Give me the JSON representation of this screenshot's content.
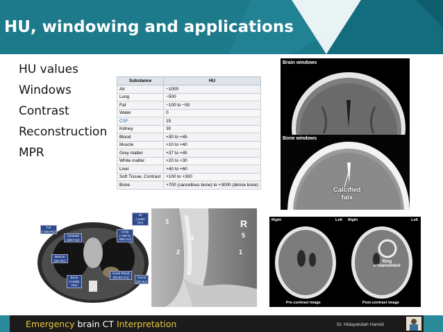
{
  "slide": {
    "title": "HU, windowing and applications",
    "bullets": [
      "HU values",
      "Windows",
      "Contrast",
      "Reconstruction",
      "MPR"
    ]
  },
  "hu_table": {
    "headers": [
      "Substance",
      "HU"
    ],
    "rows": [
      [
        "Air",
        "−1000"
      ],
      [
        "Lung",
        "−500"
      ],
      [
        "Fat",
        "−100 to −50"
      ],
      [
        "Water",
        "0"
      ],
      [
        "CSF",
        "15"
      ],
      [
        "Kidney",
        "30"
      ],
      [
        "Blood",
        "+30 to +45"
      ],
      [
        "Muscle",
        "+10 to +40"
      ],
      [
        "Grey matter",
        "+37 to +45"
      ],
      [
        "White matter",
        "+20 to +30"
      ],
      [
        "Liver",
        "+40 to +60"
      ],
      [
        "Soft Tissue, Contrast",
        "+100 to +300"
      ],
      [
        "Bone",
        "+700 (cancellous bone) to +3000 (dense bone)"
      ]
    ]
  },
  "images": {
    "brain_windows": "Brain windows",
    "bone_windows": "Bone windows",
    "calcified_falx": [
      "Calcified",
      "falx"
    ],
    "ct_labels": {
      "air": [
        "Air",
        "(-1000 HU)"
      ],
      "fat": [
        "Fat",
        "(-100 HU)"
      ],
      "lung": [
        "Lung",
        "(-750 to",
        "-900 HU)"
      ],
      "contrast": [
        "Contrast",
        "(300 HU)"
      ],
      "muscle": [
        "Muscle",
        "(50 HU)"
      ],
      "bone": [
        "Bone",
        "(>1000",
        "HU)"
      ],
      "acute_blood": [
        "Acute Blood",
        "(50-80 HU)"
      ],
      "tumor": [
        "Tumor",
        "(60 HU)"
      ]
    },
    "xray_marks": {
      "r": "R",
      "n3": "3",
      "n4": "4",
      "n2": "2",
      "n1": "1",
      "n5": "5"
    },
    "right": "Right",
    "left": "Left",
    "ring_enhancement": [
      "Ring",
      "enhancement"
    ],
    "pre_contrast": "Pre-contrast image",
    "post_contrast": "Post-contrast image"
  },
  "footer": {
    "word1": "Emergency",
    "word2": " brain CT ",
    "word3": "Interpretation",
    "author": "Dr. Hidayatullah Hamidi"
  },
  "colors": {
    "header": "#1d7a8a",
    "footer_accent": "#e7c83a",
    "footer_bg": "#1b1b1b"
  }
}
